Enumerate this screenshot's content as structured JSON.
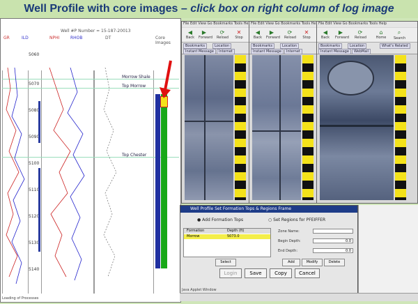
{
  "title": {
    "main": "Well Profile with core images – ",
    "emphasis": "click box on right column of log image"
  },
  "log": {
    "header_text": "Well #P Number = 15-187-20013",
    "track_titles": [
      "GR",
      "ILD",
      "NPHI",
      "RHOB",
      "DT",
      "Core Images"
    ],
    "depths": [
      "5060",
      "5070",
      "5080",
      "5090",
      "5100",
      "5110",
      "5120",
      "5130",
      "5140"
    ],
    "tops": [
      "Morrow Shale",
      "Top Morrow",
      "Top Chester"
    ],
    "status": "Loading of Processes"
  },
  "core_windows": [
    {
      "menu": "File  Edit  View  Go  Bookmarks  Tools  Help",
      "toolbar": [
        "Back",
        "Forward",
        "Reload",
        "Stop"
      ],
      "nav": [
        "Bookmarks",
        "Location"
      ],
      "pills": [
        "Instant Message",
        "WebMail",
        "Internet"
      ]
    },
    {
      "menu": "File  Edit  View  Go  Bookmarks  Tools  Help",
      "toolbar": [
        "Back",
        "Forward",
        "Reload",
        "Stop"
      ],
      "nav": [
        "Bookmarks",
        "Location"
      ],
      "pills": [
        "Instant Message",
        "WebMail",
        "Internet"
      ]
    },
    {
      "menu": "File  Edit  View  Go  Bookmarks  Tools  Help",
      "toolbar": [
        "Back",
        "Forward",
        "Reload",
        "Home",
        "Search"
      ],
      "nav": [
        "Bookmarks",
        "Location",
        "What's Related"
      ],
      "pills": [
        "Instant Message",
        "WebMail",
        "Internet"
      ]
    }
  ],
  "dialog": {
    "title": "Well Profile Set Formation Tops & Regions Frame",
    "tab_add": "Add Formation Tops",
    "tab_set": "Set Regions for PFEIFFER",
    "table_headers": [
      "Formation",
      "Depth (ft)"
    ],
    "table_rows": [
      [
        "Morrow",
        "5073.0"
      ]
    ],
    "labels": [
      "Zone Name:",
      "Begin Depth:",
      "End Depth:"
    ],
    "values": [
      "",
      "0.0",
      "0.0"
    ],
    "buttons_small": [
      "Select",
      "Add",
      "Modify",
      "Delete"
    ],
    "buttons_large": [
      "Login",
      "Save",
      "Copy",
      "Cancel"
    ],
    "status": "Java Applet Window"
  },
  "colors": {
    "accent": "#1e3c88",
    "core_bar_green": "#18a818",
    "core_bar_blue": "#2030a0",
    "scale_yellow": "#f4e21a",
    "arrow": "#e01010"
  }
}
